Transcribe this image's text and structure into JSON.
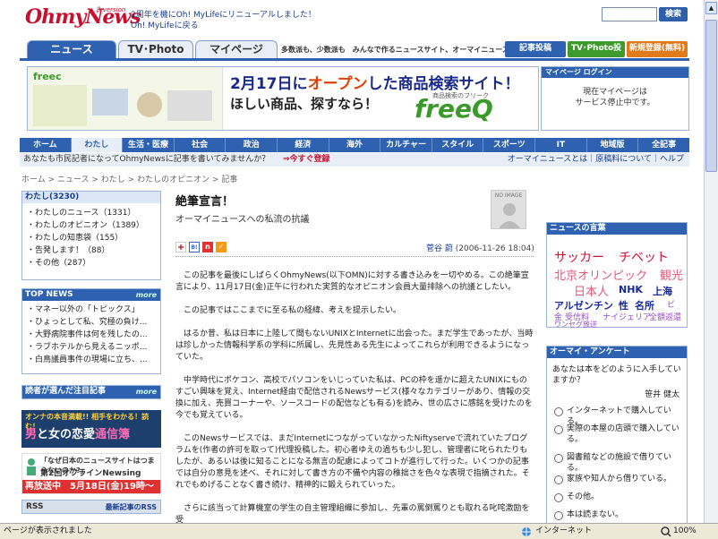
{
  "header": {
    "logo_text": "OhmyNews",
    "logo_beta": "β version",
    "news_line1": "2周年を機にOh! MyLifeにリニューアルしました！",
    "news_line2": "Oh! MyLifeに戻る",
    "search_placeholder": "",
    "search_button": "検索"
  },
  "tabs": [
    {
      "label": "ニュース"
    },
    {
      "label": "TV･Photo"
    },
    {
      "label": "マイページ"
    }
  ],
  "slogan": "多数派も、少数派も　みんなで作るニュースサイト、オーマイニュース",
  "header_buttons": {
    "post": "記事投稿",
    "tvphoto_post": "TV･Photo投稿",
    "register": "新規登録(無料)"
  },
  "banner": {
    "left_label": "freec",
    "title_prefix": "2月17日に",
    "title_main": "オープン",
    "title_suffix": "した商品検索サイト！",
    "subtitle": "ほしい商品、探すなら！",
    "logo": "freeQ",
    "logo_caption": "商品検索のフリーク"
  },
  "mypage_login": {
    "heading": "マイページ ログイン",
    "message_line1": "現在マイページは",
    "message_line2": "サービス停止中です。"
  },
  "nav": [
    {
      "label": "ホーム"
    },
    {
      "label": "わたし"
    },
    {
      "label": "生活・医療"
    },
    {
      "label": "社会"
    },
    {
      "label": "政治"
    },
    {
      "label": "経済"
    },
    {
      "label": "海外"
    },
    {
      "label": "カルチャー"
    },
    {
      "label": "スタイル"
    },
    {
      "label": "スポーツ"
    },
    {
      "label": "IT"
    },
    {
      "label": "地域版"
    },
    {
      "label": "全記事"
    }
  ],
  "infobar": {
    "left": "あなたも市民記者になってOhmyNewsに記事を書いてみませんか？",
    "register": "⇒今すぐ登録",
    "right": "オーマイニュースとは｜原稿料について｜ヘルプ"
  },
  "breadcrumb": "ホーム > ニュース > わたし > わたしのオピニオン > 記事",
  "watashi": {
    "heading": "わたし(3230)",
    "items": [
      {
        "label": "・わたしのニュース（1331）"
      },
      {
        "label": "・わたしのオピニオン（1389）"
      },
      {
        "label": "・わたしの知恵袋（155）"
      },
      {
        "label": "・告発します！（88）"
      },
      {
        "label": "・その他（287）"
      }
    ]
  },
  "topnews": {
    "heading": "TOP NEWS",
    "more": "more",
    "items": [
      {
        "label": "・マネー以外の「トピックス」"
      },
      {
        "label": "・ひょっとして私、究極の負け..."
      },
      {
        "label": "・大野病院事件は何を残したの..."
      },
      {
        "label": "・ラブホテルから見えるニッポ..."
      },
      {
        "label": "・白鳥議員事件の現場に立ち、..."
      }
    ]
  },
  "chumoku": {
    "heading": "読者が選んだ注目記事",
    "more": "more"
  },
  "ad1": {
    "line1": "オンナの本音満載!! 相手をわかる！読む！",
    "line2a": "男",
    "line2b": "と女の恋愛",
    "line2c": "通信簿"
  },
  "ad2": {
    "line1": "「なぜ日本のニュースサイトはつまらないのか?」",
    "line2": "第2回オフラインNewsing",
    "line3": "再放送中　5月18日(金)19時〜"
  },
  "rss": {
    "label": "RSS",
    "latest": "最新記事のRSS"
  },
  "article": {
    "title": "絶筆宣言！",
    "subtitle": "オーマイニュースへの私流の抗議",
    "noimage": "NO IMAGE",
    "author": "菅谷 蔚",
    "date": "(2006-11-26 18:04)",
    "paragraphs": [
      "この記事を最後にしばらくOhmyNews(以下OMN)に対する書き込みを一切やめる。この絶筆宣言により、11月17日(金)正午に行われた実質的なオピニオン会員大量排除への抗議としたい。",
      "この記事ではここまでに至る私の経緯、考えを提示したい。",
      "はるか昔、私は日本に上陸して間もないUNIXとInternetに出会った。まだ学生であったが、当時は珍しかった情報科学系の学科に所属し、先見性ある先生によってこれらが利用できるようになっていた。",
      "中学時代にポケコン、高校でパソコンをいじっていた私は、PCの枠を遥かに超えたUNIXにものすごい興味を覚え、Internet経由で配信されるNewsサービス(様々なカテゴリーがあり、情報の交換に加え、売買コーナーや、ソースコードの配信なども有る)を読み、世の広さに感銘を受けたのを今でも覚えている。",
      "このNewsサービスでは、まだInternetにつながっていなかったNiftyserveで流れていたプログラムを(作者の許可を取って)代理投稿した。初心者ゆえの過ちも少し犯し、管理者に叱られたりもしたが、あるいは後に知ることになる無言の配慮によってコトが進行して行った。いくつかの記事では自分の意見を述べ、それに対して書き方の不備や内容の稚拙さを色々な表現で指摘された。それでもめげることなく書き続け、精神的に鍛えられていった。",
      "さらに該当って計算機室の学生の自主管理組織に参加し、先輩の罵倒罵りとも取れる叱咤激励を受"
    ]
  },
  "tags": {
    "heading": "ニュースの言葉",
    "items": [
      {
        "label": "サッカー",
        "color": "#d0103a"
      },
      {
        "label": "チベット",
        "color": "#d0103a"
      },
      {
        "label": "北京オリンピック",
        "color": "#e05a7a"
      },
      {
        "label": "観光",
        "color": "#e05a7a"
      },
      {
        "label": "日本人",
        "color": "#e05a7a"
      },
      {
        "label": "NHK",
        "color": "#1a2a9a"
      },
      {
        "label": "上海",
        "color": "#1a2a9a"
      },
      {
        "label": "アルゼンチン",
        "color": "#1a2a9a"
      },
      {
        "label": "性",
        "color": "#1a2a9a"
      },
      {
        "label": "名所",
        "color": "#1a2a9a"
      },
      {
        "label": "ビ",
        "color": "#9a4ac8"
      },
      {
        "label": "金",
        "color": "#9a4ac8"
      },
      {
        "label": "受信料",
        "color": "#9a4ac8"
      },
      {
        "label": "ナイジェリア",
        "color": "#9a4ac8"
      },
      {
        "label": "全額返還",
        "color": "#9a4ac8"
      },
      {
        "label": "ワンセグ放送",
        "color": "#9a4ac8"
      }
    ]
  },
  "enquete": {
    "heading": "オーマイ・アンケート",
    "question": "あなたは本をどのように入手していますか？",
    "author": "笹井 健太",
    "options": [
      {
        "label": "インターネットで購入している。"
      },
      {
        "label": "実際の本屋の店頭で購入している。"
      },
      {
        "label": "図書館などの施設で借りている。"
      },
      {
        "label": "家族や知人から借りている。"
      },
      {
        "label": "その他。"
      },
      {
        "label": "本は読まない。"
      }
    ]
  },
  "status": {
    "left": "ページが表示されました",
    "zone": "インターネット",
    "zoom": "100%"
  },
  "colors": {
    "brand_red": "#c8102e",
    "nav_blue": "#2e62b0"
  }
}
